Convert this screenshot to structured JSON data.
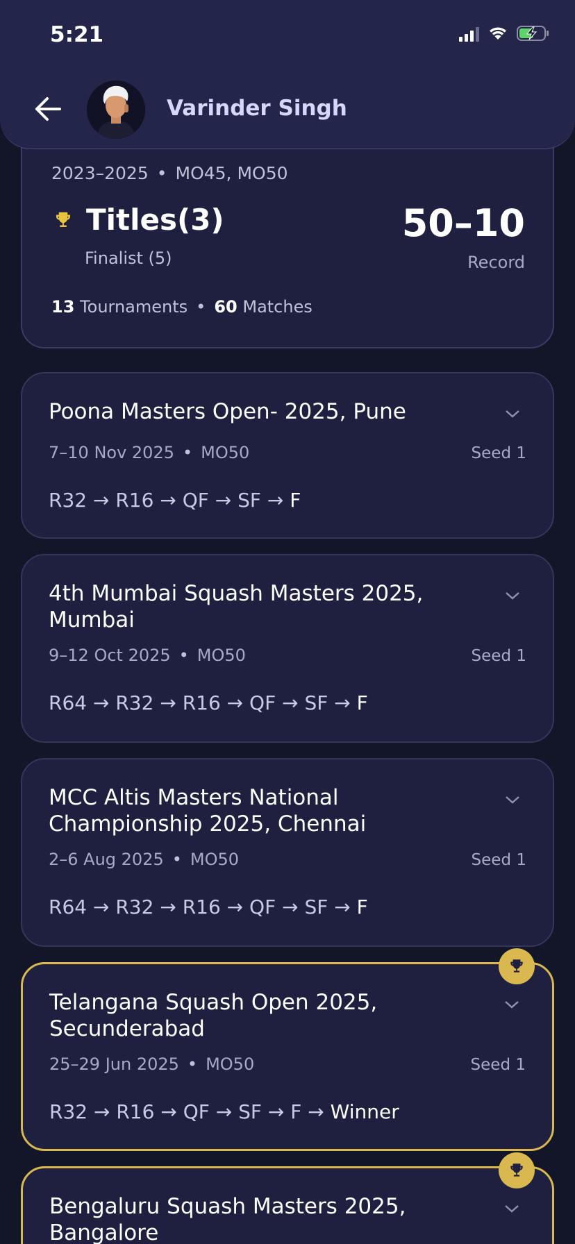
{
  "status_bar": {
    "time": "5:21"
  },
  "header": {
    "name": "Varinder Singh"
  },
  "summary": {
    "years": "2023–2025",
    "categories": "MO45, MO50",
    "titles": "Titles(3)",
    "finalist": "Finalist (5)",
    "record": "50–10",
    "record_label": "Record",
    "tournaments_count": "13",
    "tournaments_label": "Tournaments",
    "matches_count": "60",
    "matches_label": "Matches"
  },
  "tournaments": [
    {
      "title": "Poona Masters Open- 2025, Pune",
      "dates": "7–10 Nov 2025",
      "category": "MO50",
      "seed": "Seed 1",
      "progress": "R32 → R16 → QF → SF →",
      "final_step": "F"
    },
    {
      "title": "4th Mumbai Squash Masters 2025, Mumbai",
      "dates": "9–12 Oct 2025",
      "category": "MO50",
      "seed": "Seed 1",
      "progress": "R64 → R32 → R16 → QF → SF →",
      "final_step": "F"
    },
    {
      "title": "MCC Altis Masters National Championship 2025, Chennai",
      "dates": "2–6 Aug 2025",
      "category": "MO50",
      "seed": "Seed 1",
      "progress": "R64 → R32 → R16 → QF → SF →",
      "final_step": "F"
    },
    {
      "title": "Telangana Squash Open 2025, Secunderabad",
      "dates": "25–29 Jun 2025",
      "category": "MO50",
      "seed": "Seed 1",
      "progress": "R32 → R16 → QF → SF → F →",
      "final_step": "Winner"
    },
    {
      "title": "Bengaluru Squash Masters 2025, Bangalore"
    }
  ],
  "icons": {
    "back": "arrow-left-icon",
    "trophy": "trophy-icon",
    "chevron": "chevron-down-icon"
  },
  "colors": {
    "background": "#131528",
    "card": "#1f2040",
    "header": "#24254a",
    "gold": "#d9b84f",
    "accent_text": "#d6d7fb"
  }
}
